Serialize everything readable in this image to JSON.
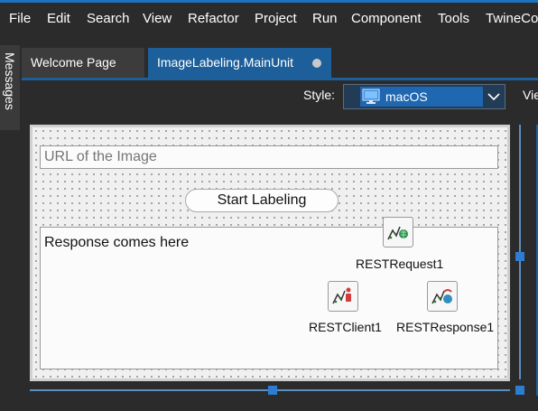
{
  "menu": [
    "File",
    "Edit",
    "Search",
    "View",
    "Refactor",
    "Project",
    "Run",
    "Component",
    "Tools",
    "TwineCo"
  ],
  "side_panel": {
    "label": "Messages"
  },
  "tabs": [
    {
      "label": "Welcome Page",
      "active": false
    },
    {
      "label": "ImageLabeling.MainUnit",
      "active": true,
      "modified": true
    }
  ],
  "toolbar": {
    "style_label": "Style:",
    "style_value": "macOS",
    "view_label": "View"
  },
  "form": {
    "url_placeholder": "URL of the Image",
    "start_button": "Start Labeling",
    "memo_text": "Response comes here",
    "components": [
      {
        "name": "RESTRequest1",
        "icon": "rest-request-icon"
      },
      {
        "name": "RESTClient1",
        "icon": "rest-client-icon"
      },
      {
        "name": "RESTResponse1",
        "icon": "rest-response-icon"
      }
    ]
  },
  "colors": {
    "accent": "#1c5f9a",
    "background": "#2b2b2b",
    "selection": "#1f67b0",
    "handle": "#2d7dd2"
  }
}
